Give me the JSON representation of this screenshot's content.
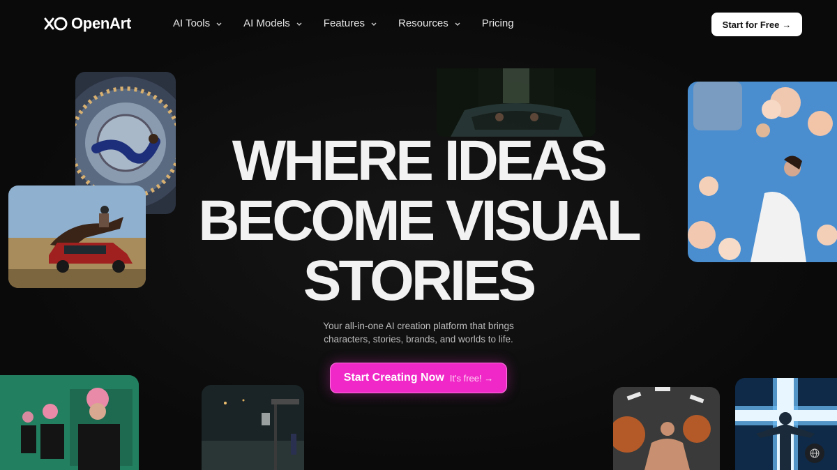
{
  "brand": {
    "name": "OpenArt"
  },
  "nav": {
    "items": [
      {
        "label": "AI Tools",
        "has_dropdown": true
      },
      {
        "label": "AI Models",
        "has_dropdown": true
      },
      {
        "label": "Features",
        "has_dropdown": true
      },
      {
        "label": "Resources",
        "has_dropdown": true
      },
      {
        "label": "Pricing",
        "has_dropdown": false
      }
    ],
    "cta_label": "Start for Free",
    "cta_arrow": "→"
  },
  "hero": {
    "headline_lines": [
      "WHERE IDEAS",
      "BECOME VISUAL",
      "STORIES"
    ],
    "subtitle_lines": [
      "Your all-in-one AI creation platform that brings",
      "characters, stories, brands, and worlds to life."
    ],
    "cta_label": "Start Creating Now",
    "cta_note": "It's free! →"
  },
  "colors": {
    "background": "#0b0b0b",
    "accent": "#f028c8",
    "text_primary": "#f2f2f2",
    "text_secondary": "#bdbdbd"
  },
  "icons": [
    "openart-logo-icon",
    "chevron-down-icon",
    "arrow-right-icon",
    "globe-icon"
  ]
}
